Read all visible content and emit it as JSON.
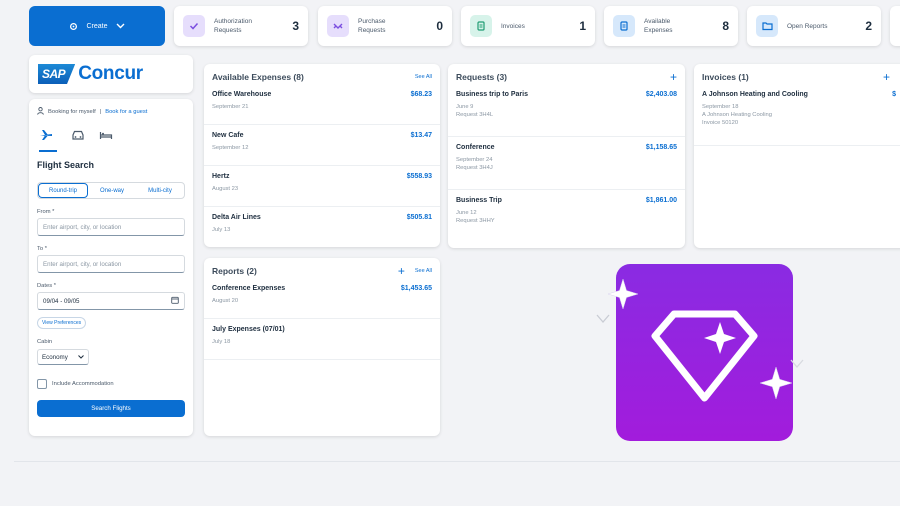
{
  "create_button": {
    "label": "Create"
  },
  "tiles": [
    {
      "label": "Authorization\nRequests",
      "count": "3",
      "icon": "check-icon",
      "icon_bg": "#e6defc",
      "icon_color": "#7b4fe0"
    },
    {
      "label": "Purchase\nRequests",
      "count": "0",
      "icon": "shuffle-icon",
      "icon_bg": "#e6defc",
      "icon_color": "#7b4fe0"
    },
    {
      "label": "Invoices",
      "count": "1",
      "icon": "invoice-icon",
      "icon_bg": "#d7f3ea",
      "icon_color": "#1f9d73"
    },
    {
      "label": "Available\nExpenses",
      "count": "8",
      "icon": "document-icon",
      "icon_bg": "#d6e8fb",
      "icon_color": "#0a6ed1"
    },
    {
      "label": "Open Reports",
      "count": "2",
      "icon": "folder-icon",
      "icon_bg": "#d6e8fb",
      "icon_color": "#0a6ed1"
    }
  ],
  "logo": {
    "sap": "SAP",
    "concur": "Concur"
  },
  "flight": {
    "booking_for": "Booking for myself",
    "separator": "|",
    "guest_link": "Book for a guest",
    "title": "Flight Search",
    "trip_types": [
      "Round-trip",
      "One-way",
      "Multi-city"
    ],
    "from_label": "From *",
    "from_placeholder": "Enter airport, city, or location",
    "to_label": "To *",
    "to_placeholder": "Enter airport, city, or location",
    "dates_label": "Dates *",
    "dates_value": "09/04 - 09/05",
    "preferences": "View Preferences",
    "cabin_label": "Cabin",
    "cabin_value": "Economy",
    "accommodation": "Include Accommodation",
    "search_button": "Search Flights"
  },
  "available_expenses": {
    "title": "Available Expenses (8)",
    "see_all": "See All",
    "items": [
      {
        "name": "Office Warehouse",
        "amount": "$68.23",
        "date": "September 21"
      },
      {
        "name": "New Cafe",
        "amount": "$13.47",
        "date": "September 12"
      },
      {
        "name": "Hertz",
        "amount": "$558.93",
        "date": "August 23"
      },
      {
        "name": "Delta Air Lines",
        "amount": "$505.81",
        "date": "July 13"
      }
    ]
  },
  "reports": {
    "title": "Reports (2)",
    "see_all": "See All",
    "items": [
      {
        "name": "Conference Expenses",
        "amount": "$1,453.65",
        "date": "August 20"
      },
      {
        "name": "July Expenses (07/01)",
        "amount": "",
        "date": "July 18"
      }
    ]
  },
  "requests": {
    "title": "Requests (3)",
    "items": [
      {
        "name": "Business trip to Paris",
        "amount": "$2,403.08",
        "date": "June 9",
        "ref": "Request 3H4L"
      },
      {
        "name": "Conference",
        "amount": "$1,158.65",
        "date": "September 24",
        "ref": "Request 3H4J"
      },
      {
        "name": "Business Trip",
        "amount": "$1,861.00",
        "date": "June 12",
        "ref": "Request 3HHY"
      }
    ]
  },
  "invoices": {
    "title": "Invoices (1)",
    "items": [
      {
        "name": "A Johnson Heating and Cooling",
        "amount": "$",
        "date": "September 18",
        "vendor": "A Johnson Heating Cooling",
        "ref": "Invoice 50120"
      }
    ]
  },
  "colors": {
    "accent": "#0a6ed1",
    "promo": "#8a2be2"
  }
}
